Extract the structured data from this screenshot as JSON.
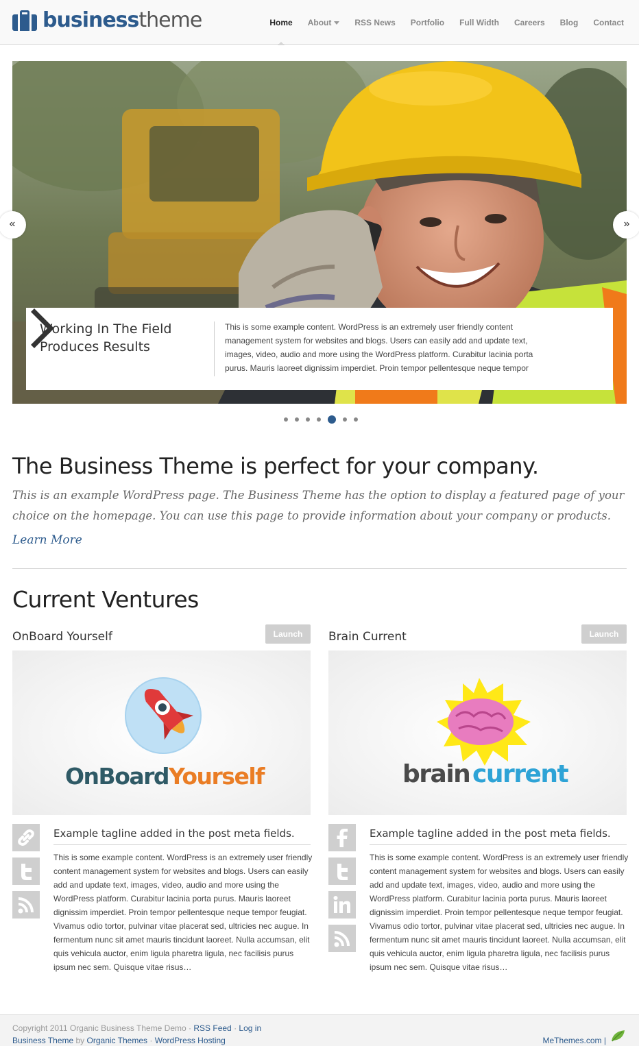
{
  "header": {
    "logo_bold": "business",
    "logo_light": "theme",
    "nav": [
      {
        "label": "Home"
      },
      {
        "label": "About"
      },
      {
        "label": "RSS News"
      },
      {
        "label": "Portfolio"
      },
      {
        "label": "Full Width"
      },
      {
        "label": "Careers"
      },
      {
        "label": "Blog"
      },
      {
        "label": "Contact"
      }
    ]
  },
  "slider": {
    "prev": "«",
    "next": "»",
    "caption_title": "Working In The Field Produces Results",
    "caption_text": "This is some example content. WordPress is an extremely user friendly content management system for websites and blogs. Users can easily add and update text, images, video, audio and more using the WordPress platform. Curabitur lacinia porta purus. Mauris laoreet dignissim imperdiet. Proin tempor pellentesque neque tempor",
    "dot_count": 7,
    "active_dot": 5
  },
  "featured": {
    "title": "The Business Theme is perfect for your company.",
    "text": "This is an example WordPress page. The Business Theme has the option to display a featured page of your choice on the homepage. You can use this page to provide information about your company or products.",
    "link": "Learn More"
  },
  "ventures": {
    "title": "Current Ventures",
    "items": [
      {
        "name": "OnBoard Yourself",
        "launch": "Launch",
        "logo_part1": "OnBoard",
        "logo_part2": "Yourself",
        "tagline": "Example tagline added in the post meta fields.",
        "text": "This is some example content. WordPress is an extremely user friendly content management system for websites and blogs. Users can easily add and update text, images, video, audio and more using the WordPress platform. Curabitur lacinia porta purus. Mauris laoreet dignissim imperdiet. Proin tempor pellentesque neque tempor feugiat. Vivamus odio tortor, pulvinar vitae placerat sed, ultricies nec augue. In fermentum nunc sit amet mauris tincidunt laoreet. Nulla accumsan, elit quis vehicula auctor, enim ligula pharetra ligula, nec facilisis purus ipsum nec sem. Quisque vitae risus…",
        "social": [
          "link-icon",
          "twitter-icon",
          "rss-icon"
        ]
      },
      {
        "name": "Brain Current",
        "launch": "Launch",
        "logo_part1": "brain",
        "logo_part2": "current",
        "tagline": "Example tagline added in the post meta fields.",
        "text": "This is some example content. WordPress is an extremely user friendly content management system for websites and blogs. Users can easily add and update text, images, video, audio and more using the WordPress platform. Curabitur lacinia porta purus. Mauris laoreet dignissim imperdiet. Proin tempor pellentesque neque tempor feugiat. Vivamus odio tortor, pulvinar vitae placerat sed, ultricies nec augue. In fermentum nunc sit amet mauris tincidunt laoreet. Nulla accumsan, elit quis vehicula auctor, enim ligula pharetra ligula, nec facilisis purus ipsum nec sem. Quisque vitae risus…",
        "social": [
          "facebook-icon",
          "twitter-icon",
          "linkedin-icon",
          "rss-icon"
        ]
      }
    ]
  },
  "footer": {
    "copyright": "Copyright 2011 Organic Business Theme Demo",
    "sep": "·",
    "rss": "RSS Feed",
    "login": "Log in",
    "theme": "Business Theme",
    "by": "by",
    "organic": "Organic Themes",
    "hosting": "WordPress Hosting",
    "methemes": "MeThemes.com |"
  },
  "colors": {
    "brand": "#2d5b8d",
    "launch_bg": "#cfcfcf"
  }
}
